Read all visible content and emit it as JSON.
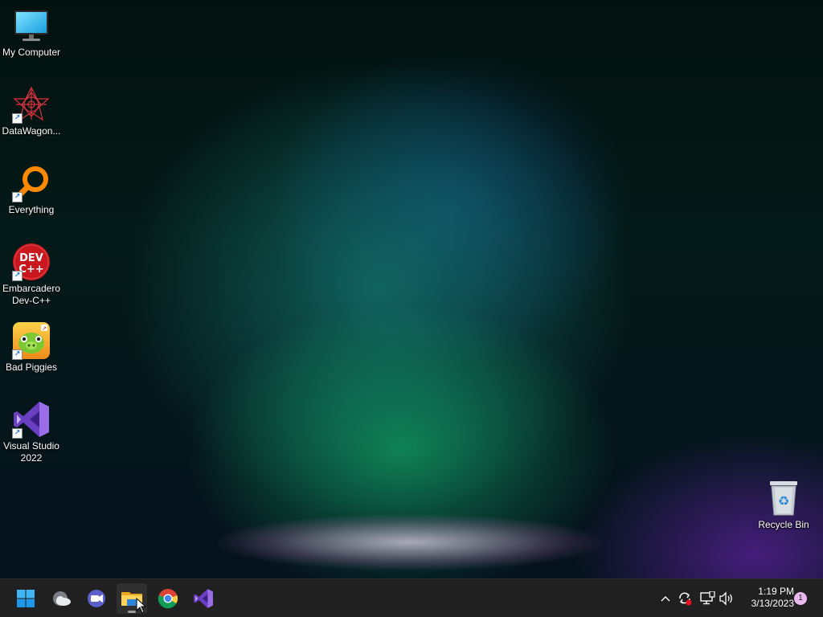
{
  "desktop": {
    "icons": [
      {
        "label": "My Computer"
      },
      {
        "label": "DataWagon..."
      },
      {
        "label": "Everything"
      },
      {
        "label": "Embarcadero\nDev-C++"
      },
      {
        "label": "Bad Piggies"
      },
      {
        "label": "Visual Studio\n2022"
      }
    ],
    "recycle_bin": {
      "label": "Recycle Bin"
    }
  },
  "taskbar": {
    "pinned": [
      "start-icon",
      "weather-icon",
      "teams-chat-icon",
      "file-explorer-icon",
      "chrome-icon",
      "visual-studio-icon"
    ],
    "clock": {
      "time": "1:19 PM",
      "date": "3/13/2023"
    },
    "notification_count": "1"
  }
}
